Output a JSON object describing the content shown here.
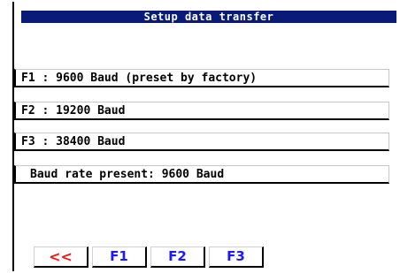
{
  "title": "Setup data transfer",
  "options": [
    "F1 : 9600 Baud (preset by factory)",
    "F2 : 19200 Baud",
    "F3 : 38400 Baud"
  ],
  "status": "Baud rate present: 9600 Baud",
  "softkeys": {
    "back": "<<",
    "f1": "F1",
    "f2": "F2",
    "f3": "F3"
  },
  "colors": {
    "title_bar": "#0a1a78",
    "back_key": "#ff1010",
    "fkey_text": "#1a1aff"
  }
}
